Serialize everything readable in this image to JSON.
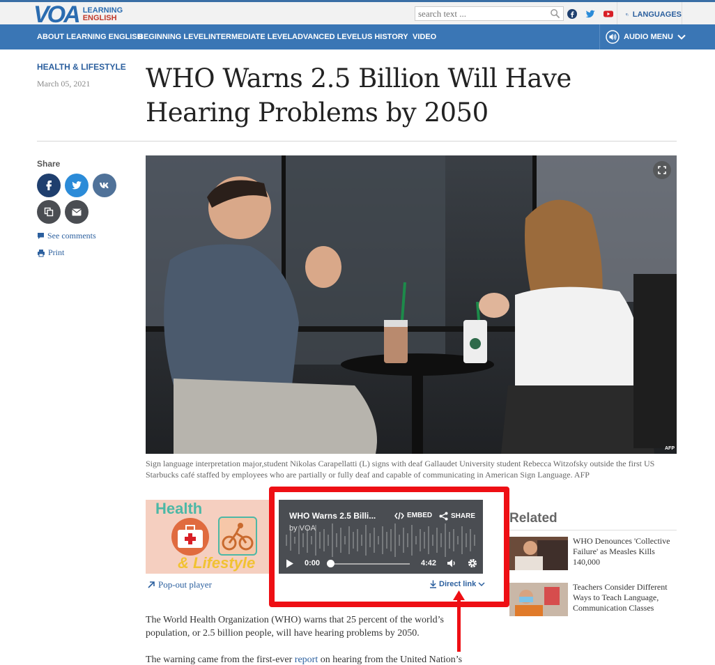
{
  "header": {
    "logo_mark": "VOA",
    "logo_line1": "LEARNING",
    "logo_line2": "ENGLISH",
    "search_placeholder": "search text ...",
    "languages_label": "LANGUAGES",
    "social_icons": [
      "facebook-icon",
      "twitter-icon",
      "youtube-icon"
    ]
  },
  "nav": {
    "items": [
      "ABOUT LEARNING ENGLISH",
      "BEGINNING LEVEL",
      "INTERMEDIATE LEVEL",
      "ADVANCED LEVEL",
      "US HISTORY",
      "VIDEO"
    ],
    "audio_menu": "AUDIO MENU"
  },
  "article": {
    "category": "HEALTH & LIFESTYLE",
    "date": "March 05, 2021",
    "title": "WHO Warns 2.5 Billion Will Have Hearing Problems by 2050",
    "share_label": "Share",
    "see_comments": "See comments",
    "print": "Print",
    "photo_credit": "AFP",
    "caption": "Sign language interpretation major,student Nikolas Carapellatti (L) signs with deaf Gallaudet University student Rebecca Witzofsky outside the first US Starbucks café staffed by employees who are partially or fully deaf and capable of communicating in American Sign Language. AFP",
    "paragraph1": "The World Health Organization (WHO) warns that 25 percent of the world’s population, or 2.5 billion people, will have hearing problems by 2050.",
    "paragraph2_before": "The warning came from the first-ever ",
    "paragraph2_link": "report",
    "paragraph2_after": " on hearing from the United Nation’s"
  },
  "audio": {
    "thumb_line1": "Health",
    "thumb_line2": "& Lifestyle",
    "popout": "Pop-out player",
    "title": "WHO Warns 2.5 Billi...",
    "by": "by VOA",
    "embed": "EMBED",
    "share": "SHARE",
    "current_time": "0:00",
    "duration": "4:42",
    "progress": 0,
    "direct_link": "Direct link"
  },
  "related": {
    "title": "Related",
    "items": [
      {
        "text": "WHO Denounces 'Collective Failure' as Measles Kills 140,000"
      },
      {
        "text": "Teachers Consider Different Ways to Teach Language, Communication Classes"
      }
    ]
  },
  "colors": {
    "brand_blue": "#3a76b5",
    "link_blue": "#2b5f9e",
    "highlight_red": "#ee0f14"
  }
}
